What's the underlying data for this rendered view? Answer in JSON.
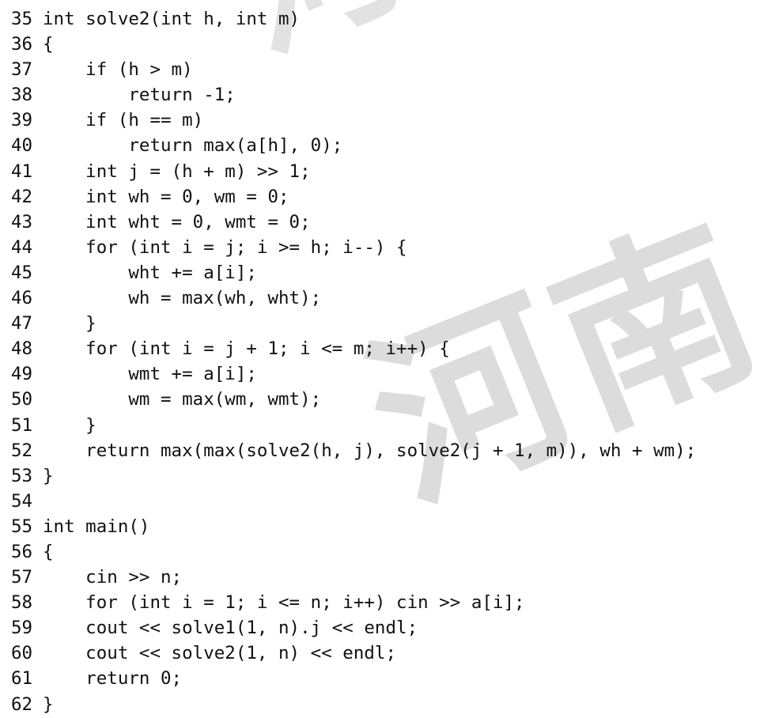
{
  "watermark": {
    "text": "河南",
    "top_fragment": "河"
  },
  "code_lines": [
    {
      "num": "35",
      "text": "int solve2(int h, int m)"
    },
    {
      "num": "36",
      "text": "{"
    },
    {
      "num": "37",
      "text": "    if (h > m)"
    },
    {
      "num": "38",
      "text": "        return -1;"
    },
    {
      "num": "39",
      "text": "    if (h == m)"
    },
    {
      "num": "40",
      "text": "        return max(a[h], 0);"
    },
    {
      "num": "41",
      "text": "    int j = (h + m) >> 1;"
    },
    {
      "num": "42",
      "text": "    int wh = 0, wm = 0;"
    },
    {
      "num": "43",
      "text": "    int wht = 0, wmt = 0;"
    },
    {
      "num": "44",
      "text": "    for (int i = j; i >= h; i--) {"
    },
    {
      "num": "45",
      "text": "        wht += a[i];"
    },
    {
      "num": "46",
      "text": "        wh = max(wh, wht);"
    },
    {
      "num": "47",
      "text": "    }"
    },
    {
      "num": "48",
      "text": "    for (int i = j + 1; i <= m; i++) {"
    },
    {
      "num": "49",
      "text": "        wmt += a[i];"
    },
    {
      "num": "50",
      "text": "        wm = max(wm, wmt);"
    },
    {
      "num": "51",
      "text": "    }"
    },
    {
      "num": "52",
      "text": "    return max(max(solve2(h, j), solve2(j + 1, m)), wh + wm);"
    },
    {
      "num": "53",
      "text": "}"
    },
    {
      "num": "54",
      "text": ""
    },
    {
      "num": "55",
      "text": "int main()"
    },
    {
      "num": "56",
      "text": "{"
    },
    {
      "num": "57",
      "text": "    cin >> n;"
    },
    {
      "num": "58",
      "text": "    for (int i = 1; i <= n; i++) cin >> a[i];"
    },
    {
      "num": "59",
      "text": "    cout << solve1(1, n).j << endl;"
    },
    {
      "num": "60",
      "text": "    cout << solve2(1, n) << endl;"
    },
    {
      "num": "61",
      "text": "    return 0;"
    },
    {
      "num": "62",
      "text": "}"
    }
  ]
}
